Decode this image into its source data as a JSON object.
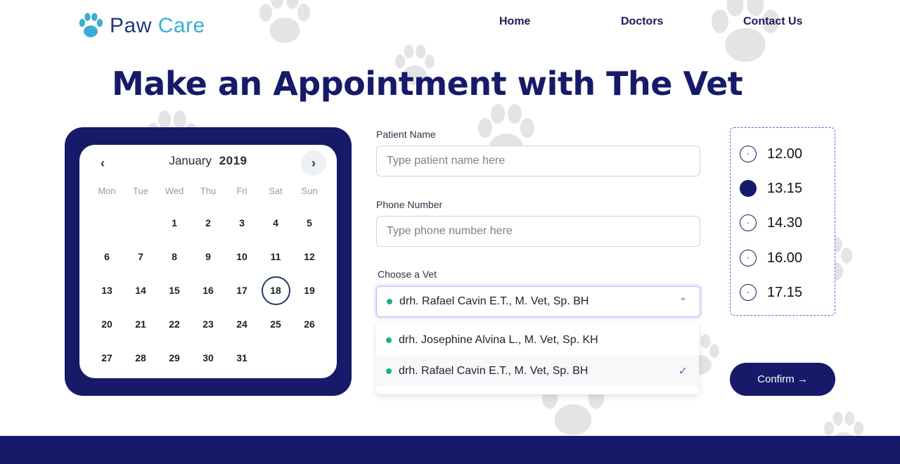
{
  "brand": {
    "word1": "Paw",
    "word2": "Care",
    "color_primary": "#1e3a7a",
    "color_accent": "#3aaed4"
  },
  "nav": {
    "items": [
      "Home",
      "Doctors",
      "Contact Us"
    ]
  },
  "page_title": "Make an Appointment with The Vet",
  "calendar": {
    "month": "January",
    "year": "2019",
    "prev_icon": "chevron-left-icon",
    "next_icon": "chevron-right-icon",
    "weekdays": [
      "Mon",
      "Tue",
      "Wed",
      "Thu",
      "Fri",
      "Sat",
      "Sun"
    ],
    "days": [
      "1",
      "2",
      "3",
      "4",
      "5",
      "6",
      "7",
      "8",
      "9",
      "10",
      "11",
      "12",
      "13",
      "14",
      "15",
      "16",
      "17",
      "18",
      "19",
      "20",
      "21",
      "22",
      "23",
      "24",
      "25",
      "26",
      "27",
      "28",
      "29",
      "30",
      "31"
    ],
    "selected_day": "18"
  },
  "form": {
    "patient_label": "Patient Name",
    "patient_placeholder": "Type patient name here",
    "phone_label": "Phone Number",
    "phone_placeholder": "Type phone number here",
    "vet_label": "Choose a Vet",
    "vet_selected": "drh. Rafael Cavin E.T., M. Vet, Sp. BH",
    "vet_options": [
      "drh. Josephine Alvina L., M. Vet, Sp. KH",
      "drh. Rafael Cavin E.T., M. Vet, Sp. BH"
    ]
  },
  "times": {
    "options": [
      "12.00",
      "13.15",
      "14.30",
      "16.00",
      "17.15"
    ],
    "selected": "13.15"
  },
  "confirm_label": "Confirm →",
  "colors": {
    "navy": "#171a69",
    "status_dot": "#21b36b",
    "check": "#6d5bd0"
  }
}
